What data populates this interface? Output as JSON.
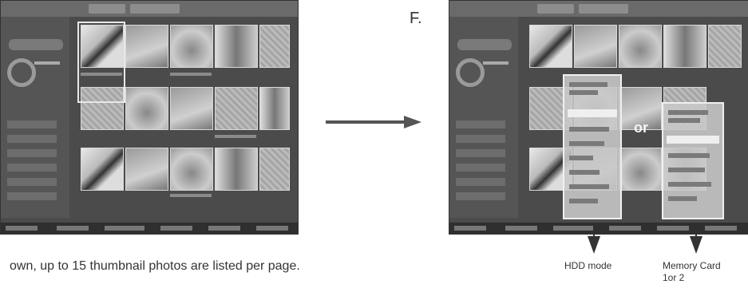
{
  "figure_letter": "F.",
  "or_label": "or",
  "caption": "own, up to 15 thumbnail photos are listed per page.",
  "labels": {
    "hdd_mode": "HDD mode",
    "memory_card_line1": "Memory Card",
    "memory_card_line2": "1or 2"
  },
  "colors": {
    "screen_bg": "#4b4b4b",
    "menu_bg": "#c8c8c8",
    "arrow": "#555555"
  }
}
